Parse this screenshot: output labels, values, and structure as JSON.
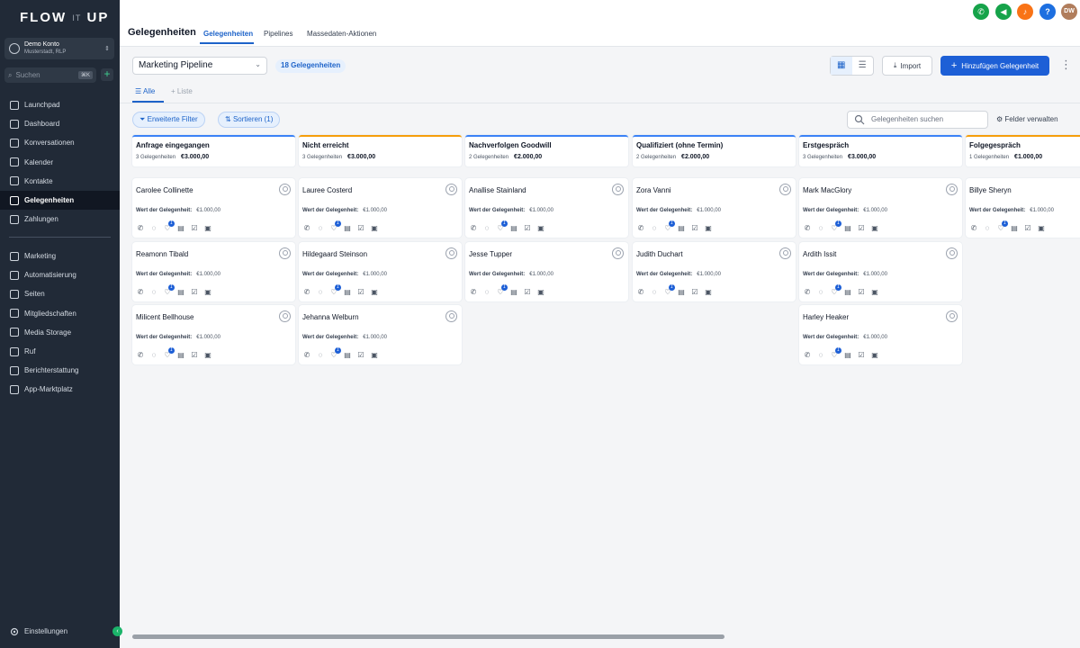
{
  "sidebar": {
    "logo": {
      "main1": "FLOW",
      "it": "IT",
      "main2": "UP"
    },
    "account": {
      "name": "Demo Konto",
      "location": "Musterstadt, RLP"
    },
    "search": {
      "placeholder": "Suchen",
      "shortcut": "⌘K"
    },
    "nav": [
      {
        "label": "Launchpad",
        "icon": "launchpad-icon"
      },
      {
        "label": "Dashboard",
        "icon": "dashboard-icon"
      },
      {
        "label": "Konversationen",
        "icon": "chat-icon"
      },
      {
        "label": "Kalender",
        "icon": "calendar-icon"
      },
      {
        "label": "Kontakte",
        "icon": "contacts-icon"
      },
      {
        "label": "Gelegenheiten",
        "icon": "opportunities-icon",
        "active": true
      },
      {
        "label": "Zahlungen",
        "icon": "payments-icon"
      }
    ],
    "nav2": [
      {
        "label": "Marketing",
        "icon": "send-icon"
      },
      {
        "label": "Automatisierung",
        "icon": "automation-icon"
      },
      {
        "label": "Seiten",
        "icon": "pages-icon"
      },
      {
        "label": "Mitgliedschaften",
        "icon": "membership-icon"
      },
      {
        "label": "Media Storage",
        "icon": "media-icon"
      },
      {
        "label": "Ruf",
        "icon": "star-icon"
      },
      {
        "label": "Berichterstattung",
        "icon": "report-icon"
      },
      {
        "label": "App-Marktplatz",
        "icon": "apps-icon"
      }
    ],
    "settings": "Einstellungen"
  },
  "header": {
    "title": "Gelegenheiten",
    "tabs": [
      "Gelegenheiten",
      "Pipelines",
      "Massedaten-Aktionen"
    ],
    "avatar": "DW",
    "help": "?"
  },
  "toolbar": {
    "pipeline": "Marketing Pipeline",
    "count": "18 Gelegenheiten",
    "import": "Import",
    "add": "Hinzufügen Gelegenheit"
  },
  "views": {
    "all": "Alle",
    "list": "Liste"
  },
  "filters": {
    "advanced": "Erweiterte Filter",
    "sort": "Sortieren (1)",
    "search_placeholder": "Gelegenheiten suchen",
    "fields": "Felder verwalten"
  },
  "card_value_label": "Wert der Gelegenheit:",
  "colors": {
    "primary": "#1d5fd6",
    "stage_blue": "#3b82f6",
    "stage_orange": "#f59e0b",
    "sidebar": "#212a37"
  },
  "columns": [
    {
      "name": "Anfrage eingegangen",
      "count": "3 Gelegenheiten",
      "total": "€3.000,00",
      "color": "#3b82f6",
      "cards": [
        {
          "name": "Carolee Collinette",
          "value": "€1.000,00"
        },
        {
          "name": "Reamonn Tibald",
          "value": "€1.000,00"
        },
        {
          "name": "Milicent Bellhouse",
          "value": "€1.000,00"
        }
      ]
    },
    {
      "name": "Nicht erreicht",
      "count": "3 Gelegenheiten",
      "total": "€3.000,00",
      "color": "#f59e0b",
      "cards": [
        {
          "name": "Lauree Costerd",
          "value": "€1.000,00"
        },
        {
          "name": "Hildegaard Steinson",
          "value": "€1.000,00"
        },
        {
          "name": "Jehanna Welburn",
          "value": "€1.000,00"
        }
      ]
    },
    {
      "name": "Nachverfolgen Goodwill",
      "count": "2 Gelegenheiten",
      "total": "€2.000,00",
      "color": "#3b82f6",
      "cards": [
        {
          "name": "Anallise Stainland",
          "value": "€1.000,00"
        },
        {
          "name": "Jesse Tupper",
          "value": "€1.000,00"
        }
      ]
    },
    {
      "name": "Qualifiziert (ohne Termin)",
      "count": "2 Gelegenheiten",
      "total": "€2.000,00",
      "color": "#3b82f6",
      "cards": [
        {
          "name": "Zora Vanni",
          "value": "€1.000,00"
        },
        {
          "name": "Judith Duchart",
          "value": "€1.000,00"
        }
      ]
    },
    {
      "name": "Erstgespräch",
      "count": "3 Gelegenheiten",
      "total": "€3.000,00",
      "color": "#3b82f6",
      "cards": [
        {
          "name": "Mark MacGlory",
          "value": "€1.000,00"
        },
        {
          "name": "Ardith Issit",
          "value": "€1.000,00"
        },
        {
          "name": "Harley Heaker",
          "value": "€1.000,00"
        }
      ]
    },
    {
      "name": "Folgegespräch",
      "count": "1 Gelegenheiten",
      "total": "€1.000,00",
      "color": "#f59e0b",
      "cards": [
        {
          "name": "Billye Sheryn",
          "value": "€1.000,00"
        }
      ]
    }
  ]
}
